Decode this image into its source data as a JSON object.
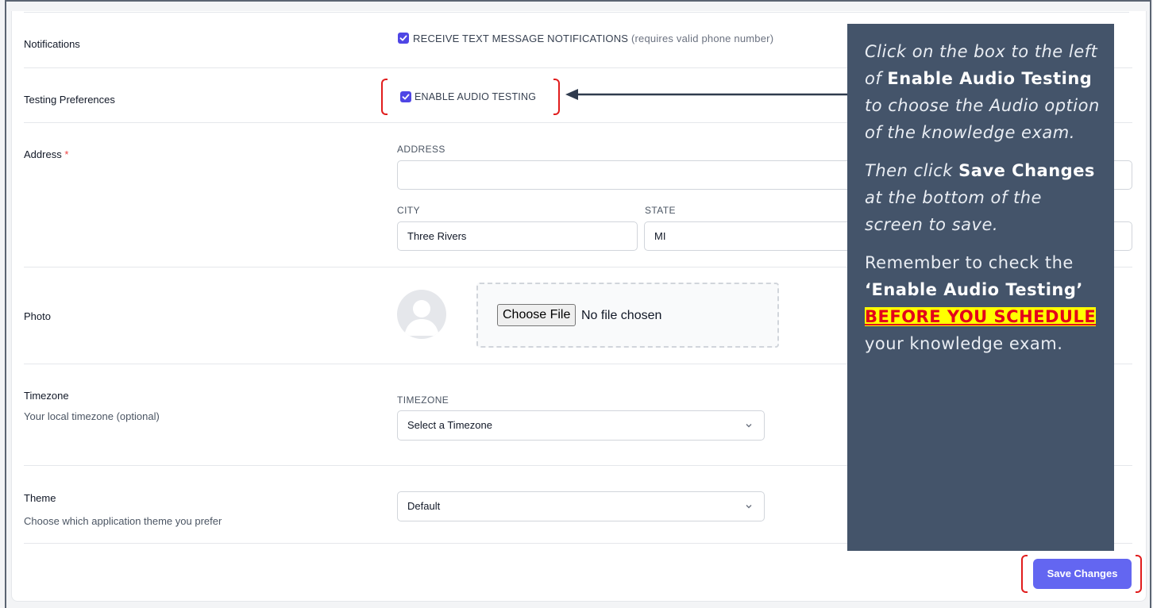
{
  "notifications": {
    "label": "Notifications",
    "checkbox_label": "RECEIVE TEXT MESSAGE NOTIFICATIONS",
    "checkbox_hint": "(requires valid phone number)",
    "checked": true
  },
  "testing": {
    "label": "Testing Preferences",
    "checkbox_label": "ENABLE AUDIO TESTING",
    "checked": true
  },
  "address": {
    "label": "Address",
    "required_mark": "*",
    "address_label": "ADDRESS",
    "address_value": "",
    "city_label": "CITY",
    "city_value": "Three Rivers",
    "state_label": "STATE",
    "state_value": "MI"
  },
  "photo": {
    "label": "Photo",
    "file_button": "Choose File",
    "file_status": "No file chosen"
  },
  "timezone": {
    "label": "Timezone",
    "sublabel": "Your local timezone (optional)",
    "field_label": "TIMEZONE",
    "selected": "Select a Timezone"
  },
  "theme": {
    "label": "Theme",
    "sublabel": "Choose which application theme you prefer",
    "selected": "Default"
  },
  "save_button": "Save Changes",
  "callout": {
    "p1_a": "Click on the box to the left of ",
    "p1_b": "Enable Audio Testing",
    "p1_c": " to choose the Audio option of the knowledge exam.",
    "p2_a": "Then click ",
    "p2_b": "Save Changes",
    "p2_c": " at the bottom of the screen to save.",
    "p3_a": "Remember to check the ",
    "p3_b": "‘Enable Audio Testing’",
    "p3_c": " ",
    "p3_hl": "BEFORE YOU SCHEDULE",
    "p3_d": " your knowledge exam."
  },
  "colors": {
    "accent": "#4f46e5",
    "save_button": "#6366f1",
    "callout_bg": "#44546a",
    "annotation_red": "#e11d1d",
    "highlight": "#ffff00"
  }
}
